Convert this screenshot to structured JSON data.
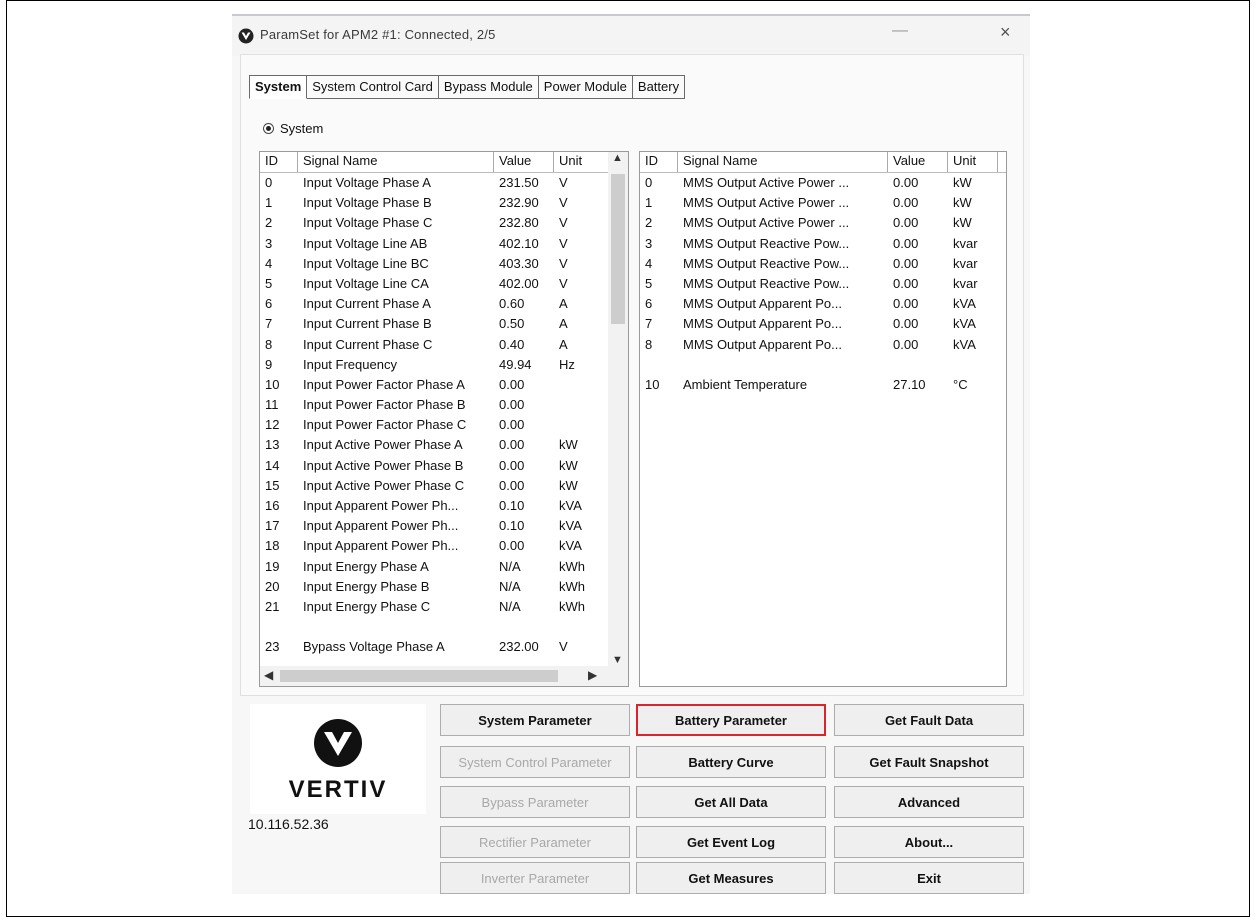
{
  "window": {
    "title": "ParamSet for  APM2 #1: Connected, 2/5",
    "close_glyph": "×",
    "minimize_glyph": "—"
  },
  "tabs": [
    "System",
    "System Control Card",
    "Bypass Module",
    "Power Module",
    "Battery"
  ],
  "radio": {
    "label": "System",
    "checked": true
  },
  "left_table": {
    "headers": {
      "id": "ID",
      "signal": "Signal Name",
      "value": "Value",
      "unit": "Unit"
    },
    "rows": [
      {
        "id": "0",
        "signal": "Input Voltage Phase A",
        "value": "231.50",
        "unit": "V"
      },
      {
        "id": "1",
        "signal": "Input Voltage Phase B",
        "value": "232.90",
        "unit": "V"
      },
      {
        "id": "2",
        "signal": "Input Voltage Phase C",
        "value": "232.80",
        "unit": "V"
      },
      {
        "id": "3",
        "signal": "Input Voltage Line AB",
        "value": "402.10",
        "unit": "V"
      },
      {
        "id": "4",
        "signal": "Input Voltage Line BC",
        "value": "403.30",
        "unit": "V"
      },
      {
        "id": "5",
        "signal": "Input Voltage Line CA",
        "value": "402.00",
        "unit": "V"
      },
      {
        "id": "6",
        "signal": "Input Current Phase A",
        "value": "0.60",
        "unit": "A"
      },
      {
        "id": "7",
        "signal": "Input Current Phase B",
        "value": "0.50",
        "unit": "A"
      },
      {
        "id": "8",
        "signal": "Input Current Phase C",
        "value": "0.40",
        "unit": "A"
      },
      {
        "id": "9",
        "signal": "Input Frequency",
        "value": "49.94",
        "unit": "Hz"
      },
      {
        "id": "10",
        "signal": "Input Power Factor Phase A",
        "value": "0.00",
        "unit": ""
      },
      {
        "id": "11",
        "signal": "Input Power Factor Phase B",
        "value": "0.00",
        "unit": ""
      },
      {
        "id": "12",
        "signal": "Input Power Factor Phase C",
        "value": "0.00",
        "unit": ""
      },
      {
        "id": "13",
        "signal": "Input Active Power Phase A",
        "value": "0.00",
        "unit": "kW"
      },
      {
        "id": "14",
        "signal": "Input Active Power Phase B",
        "value": "0.00",
        "unit": "kW"
      },
      {
        "id": "15",
        "signal": "Input Active Power Phase C",
        "value": "0.00",
        "unit": "kW"
      },
      {
        "id": "16",
        "signal": "Input Apparent Power Ph...",
        "value": "0.10",
        "unit": "kVA"
      },
      {
        "id": "17",
        "signal": "Input Apparent Power Ph...",
        "value": "0.10",
        "unit": "kVA"
      },
      {
        "id": "18",
        "signal": "Input Apparent Power Ph...",
        "value": "0.00",
        "unit": "kVA"
      },
      {
        "id": "19",
        "signal": "Input Energy Phase A",
        "value": "N/A",
        "unit": "kWh"
      },
      {
        "id": "20",
        "signal": "Input Energy Phase B",
        "value": "N/A",
        "unit": "kWh"
      },
      {
        "id": "21",
        "signal": "Input Energy Phase C",
        "value": "N/A",
        "unit": "kWh"
      },
      {
        "id": "",
        "signal": "",
        "value": "",
        "unit": ""
      },
      {
        "id": "23",
        "signal": "Bypass Voltage Phase A",
        "value": "232.00",
        "unit": "V"
      }
    ]
  },
  "right_table": {
    "headers": {
      "id": "ID",
      "signal": "Signal Name",
      "value": "Value",
      "unit": "Unit"
    },
    "rows": [
      {
        "id": "0",
        "signal": "MMS Output Active Power ...",
        "value": "0.00",
        "unit": "kW"
      },
      {
        "id": "1",
        "signal": "MMS Output Active Power ...",
        "value": "0.00",
        "unit": "kW"
      },
      {
        "id": "2",
        "signal": "MMS Output Active Power ...",
        "value": "0.00",
        "unit": "kW"
      },
      {
        "id": "3",
        "signal": "MMS Output Reactive Pow...",
        "value": "0.00",
        "unit": "kvar"
      },
      {
        "id": "4",
        "signal": "MMS Output Reactive Pow...",
        "value": "0.00",
        "unit": "kvar"
      },
      {
        "id": "5",
        "signal": "MMS Output Reactive Pow...",
        "value": "0.00",
        "unit": "kvar"
      },
      {
        "id": "6",
        "signal": "MMS Output Apparent Po...",
        "value": "0.00",
        "unit": "kVA"
      },
      {
        "id": "7",
        "signal": "MMS Output Apparent Po...",
        "value": "0.00",
        "unit": "kVA"
      },
      {
        "id": "8",
        "signal": "MMS Output Apparent Po...",
        "value": "0.00",
        "unit": "kVA"
      },
      {
        "id": "",
        "signal": "",
        "value": "",
        "unit": ""
      },
      {
        "id": "10",
        "signal": "Ambient Temperature",
        "value": "27.10",
        "unit": "°C"
      }
    ]
  },
  "logo": {
    "brand": "VERTIV",
    "ip": "10.116.52.36"
  },
  "buttons": {
    "col1": [
      {
        "label": "System Parameter",
        "enabled": true
      },
      {
        "label": "System Control Parameter",
        "enabled": false
      },
      {
        "label": "Bypass Parameter",
        "enabled": false
      },
      {
        "label": "Rectifier Parameter",
        "enabled": false
      },
      {
        "label": "Inverter Parameter",
        "enabled": false
      }
    ],
    "col2": [
      {
        "label": "Battery Parameter",
        "enabled": true,
        "highlighted": true
      },
      {
        "label": "Battery Curve",
        "enabled": true
      },
      {
        "label": "Get All Data",
        "enabled": true
      },
      {
        "label": "Get Event Log",
        "enabled": true
      },
      {
        "label": "Get Measures",
        "enabled": true
      }
    ],
    "col3": [
      {
        "label": "Get Fault Data",
        "enabled": true
      },
      {
        "label": "Get Fault Snapshot",
        "enabled": true
      },
      {
        "label": "Advanced",
        "enabled": true
      },
      {
        "label": "About...",
        "enabled": true
      },
      {
        "label": "Exit",
        "enabled": true
      }
    ]
  },
  "colors": {
    "highlight_border": "#d9262c",
    "disabled_text": "#a8a8a8"
  },
  "icons": [
    "app-logo-icon",
    "minimize-icon",
    "close-icon",
    "scroll-up-icon",
    "scroll-down-icon",
    "scroll-left-icon",
    "scroll-right-icon",
    "vertiv-logo-icon"
  ]
}
